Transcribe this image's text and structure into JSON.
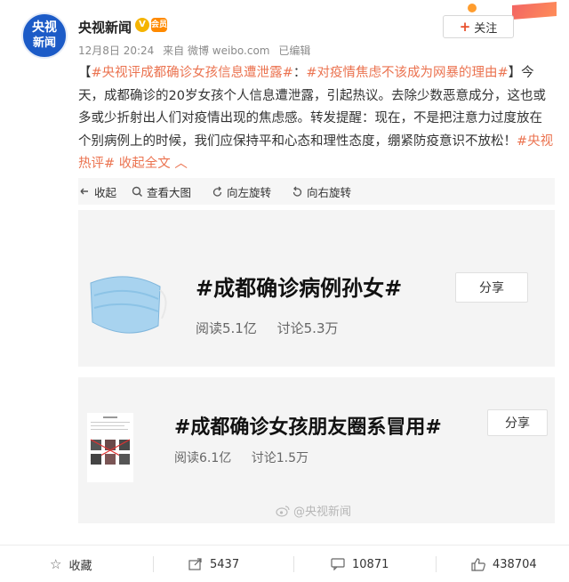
{
  "author": {
    "avatar_line1": "央视",
    "avatar_line2": "新闻",
    "name": "央视新闻",
    "verify_badge": "V",
    "vip_badge": "会员"
  },
  "post_meta": {
    "date": "12月8日 20:24",
    "source": "来自 微博 weibo.com",
    "edited": "已编辑"
  },
  "follow_label": "关注",
  "post": {
    "open_bracket": "【",
    "tag1": "#央视评成都确诊女孩信息遭泄露#",
    "colon": "：",
    "tag2": "#对疫情焦虑不该成为网暴的理由#",
    "close_bracket": "】",
    "body": "今天，成都确诊的20岁女孩个人信息遭泄露，引起热议。去除少数恶意成分，这也或多或少折射出人们对疫情出现的焦虑感。转发提醒：现在，不是把注意力过度放在个别病例上的时候，我们应保持平和心态和理性态度，绷紧防疫意识不放松！",
    "tag3": "#央视热评#",
    "collapse": "收起全文",
    "collapse_arrow": "︿"
  },
  "toolbar": {
    "collapse": "收起",
    "view_large": "查看大图",
    "rotate_left": "向左旋转",
    "rotate_right": "向右旋转"
  },
  "topic_cards": [
    {
      "title": "#成都确诊病例孙女#",
      "reads": "阅读5.1亿",
      "discussions": "讨论5.3万",
      "share": "分享"
    },
    {
      "title": "#成都确诊女孩朋友圈系冒用#",
      "reads": "阅读6.1亿",
      "discussions": "讨论1.5万",
      "share": "分享"
    }
  ],
  "watermark": "@央视新闻",
  "footer": {
    "favorite": "收藏",
    "reposts": "5437",
    "comments": "10871",
    "likes": "438704"
  },
  "colors": {
    "link_orange": "#eb7350",
    "avatar_blue": "#1c5bc7",
    "card_bg": "#f4f4f4"
  }
}
